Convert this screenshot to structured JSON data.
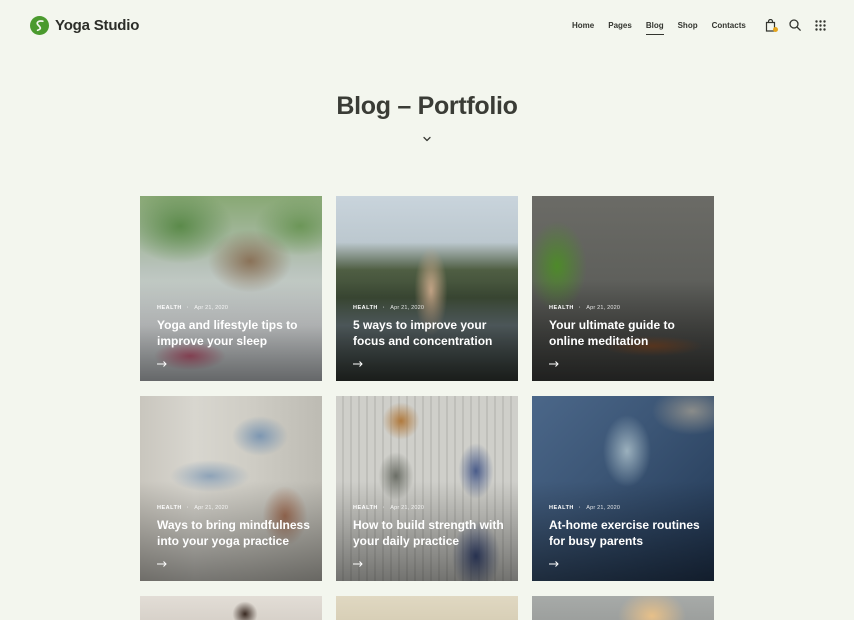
{
  "brand": {
    "name": "Yoga Studio",
    "accent": "#4a9a2e"
  },
  "nav": {
    "items": [
      {
        "label": "Home",
        "active": false
      },
      {
        "label": "Pages",
        "active": false
      },
      {
        "label": "Blog",
        "active": true
      },
      {
        "label": "Shop",
        "active": false
      },
      {
        "label": "Contacts",
        "active": false
      }
    ]
  },
  "header_icons": [
    "cart-icon",
    "search-icon",
    "grid-menu-icon"
  ],
  "page": {
    "title": "Blog – Portfolio"
  },
  "posts": [
    {
      "category": "HEALTH",
      "date": "Apr 21, 2020",
      "title": "Yoga and lifestyle tips to improve your sleep"
    },
    {
      "category": "HEALTH",
      "date": "Apr 21, 2020",
      "title": "5 ways to improve your focus and concentration"
    },
    {
      "category": "HEALTH",
      "date": "Apr 21, 2020",
      "title": "Your ultimate guide to online meditation"
    },
    {
      "category": "HEALTH",
      "date": "Apr 21, 2020",
      "title": "Ways to bring mindfulness into your yoga practice"
    },
    {
      "category": "HEALTH",
      "date": "Apr 21, 2020",
      "title": "How to build strength with your daily practice"
    },
    {
      "category": "HEALTH",
      "date": "Apr 21, 2020",
      "title": "At-home exercise routines for busy parents"
    }
  ]
}
